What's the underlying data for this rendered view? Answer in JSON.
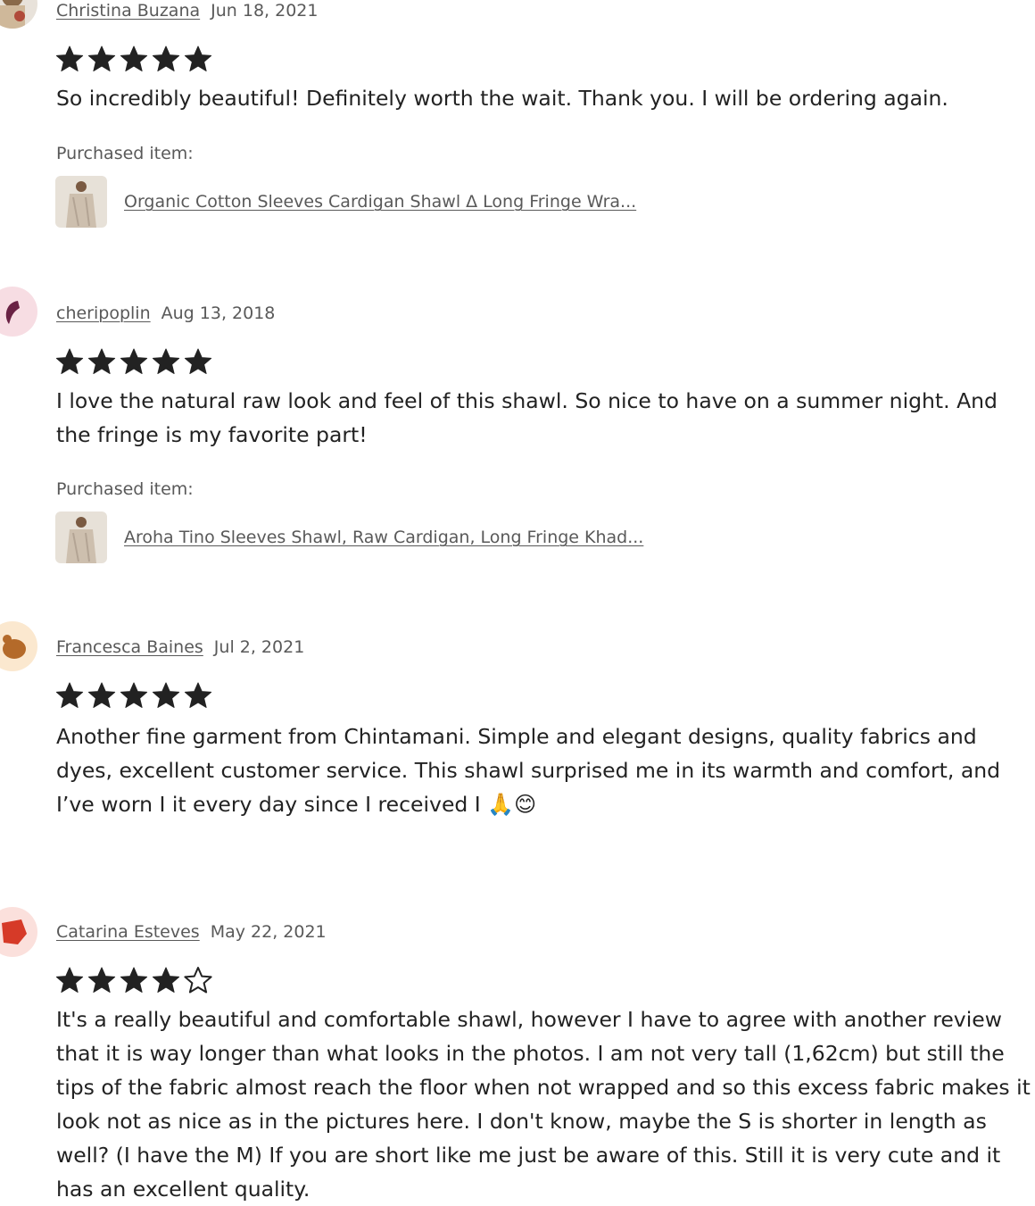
{
  "purchased_label": "Purchased item:",
  "reviews": [
    {
      "name": "Christina Buzana",
      "date": "Jun 18, 2021",
      "rating": 5,
      "text": "So incredibly beautiful! Definitely worth the wait. Thank you. I will be ordering again.",
      "item": "Organic Cotton Sleeves Cardigan Shawl Δ Long Fringe Wra..."
    },
    {
      "name": "cheripoplin",
      "date": "Aug 13, 2018",
      "rating": 5,
      "text": "I love the natural raw look and feel of this shawl. So nice to have on a summer night. And the fringe is my favorite part!",
      "item": "Aroha Tino Sleeves Shawl, Raw Cardigan, Long Fringe Khad..."
    },
    {
      "name": "Francesca Baines",
      "date": "Jul 2, 2021",
      "rating": 5,
      "text": "Another fine garment from Chintamani. Simple and elegant designs, quality fabrics and dyes, excellent customer service. This shawl surprised me in its warmth and comfort, and I’ve worn I it every day since I received I",
      "emoji": "🙏😊"
    },
    {
      "name": "Catarina Esteves",
      "date": "May 22, 2021",
      "rating": 4,
      "text": "It's a really beautiful and comfortable shawl, however I have to agree with another review that it is way longer than what looks in the photos. I am not very tall (1,62cm) but still the tips of the fabric almost reach the floor when not wrapped and so this excess fabric makes it look not as nice as in the pictures here. I don't know, maybe the S is shorter in length as well? (I have the M) If you are short like me just be aware of this. Still it is very cute and it has an excellent quality."
    }
  ],
  "icons": {
    "star_filled": "star-filled-icon",
    "star_empty": "star-outline-icon"
  },
  "colors": {
    "text": "#222222",
    "muted": "#595959",
    "star": "#222222"
  }
}
